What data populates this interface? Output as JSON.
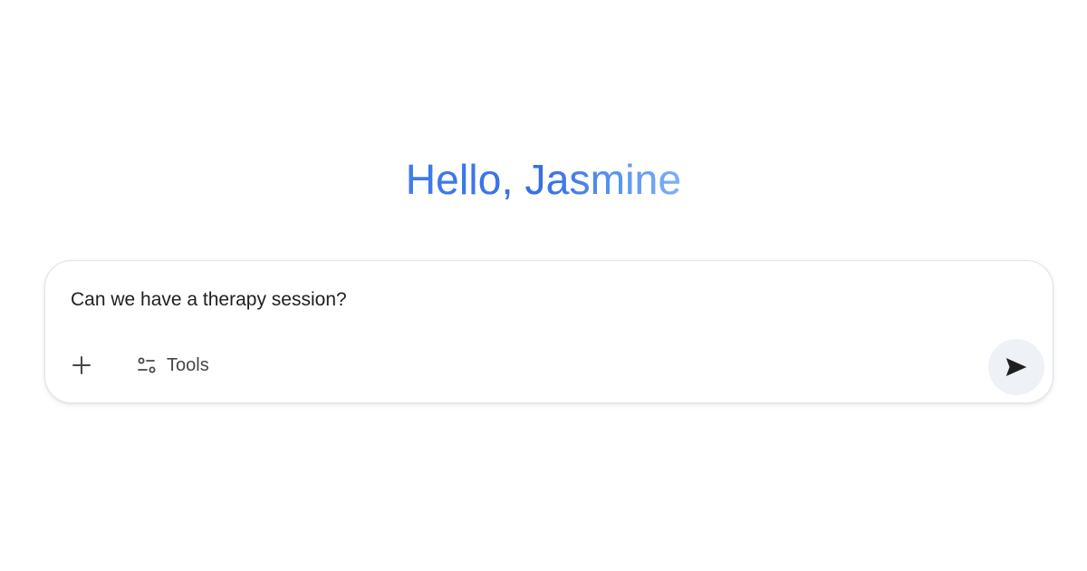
{
  "greeting": {
    "text": "Hello, Jasmine"
  },
  "composer": {
    "input_value": "Can we have a therapy session?",
    "add_icon": "plus-icon",
    "tools_icon": "sliders-icon",
    "tools_label": "Tools",
    "send_icon": "send-arrow-icon"
  },
  "colors": {
    "greeting_gradient_start": "#3d7cf0",
    "greeting_gradient_end": "#7fb0f7",
    "send_button_bg": "#eef1f6",
    "text": "#1f1f1f"
  }
}
